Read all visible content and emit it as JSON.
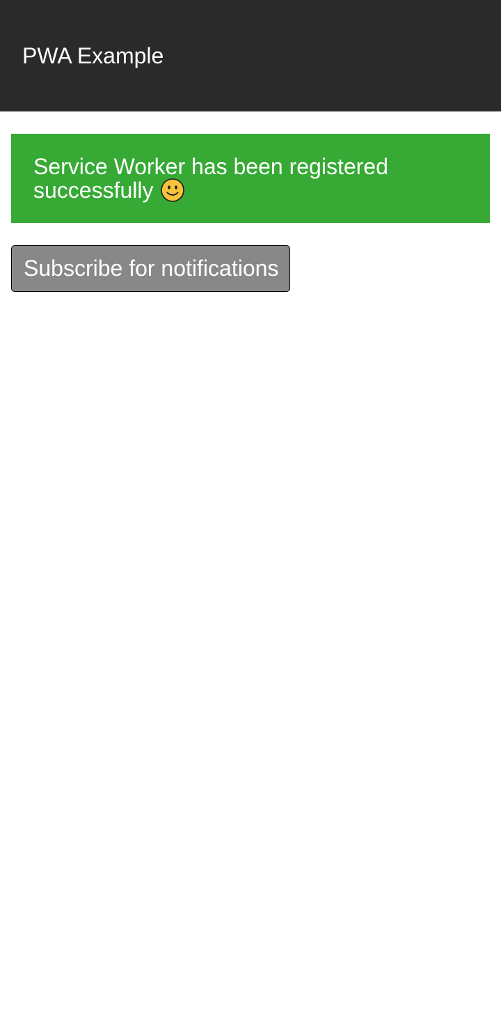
{
  "header": {
    "title": "PWA Example",
    "background": "#2a2a2a"
  },
  "status": {
    "message": "Service Worker has been registered successfully",
    "icon": "smiley-icon",
    "background": "#37a935"
  },
  "actions": {
    "subscribe_label": "Subscribe for notifications",
    "subscribe_background": "#888888"
  }
}
